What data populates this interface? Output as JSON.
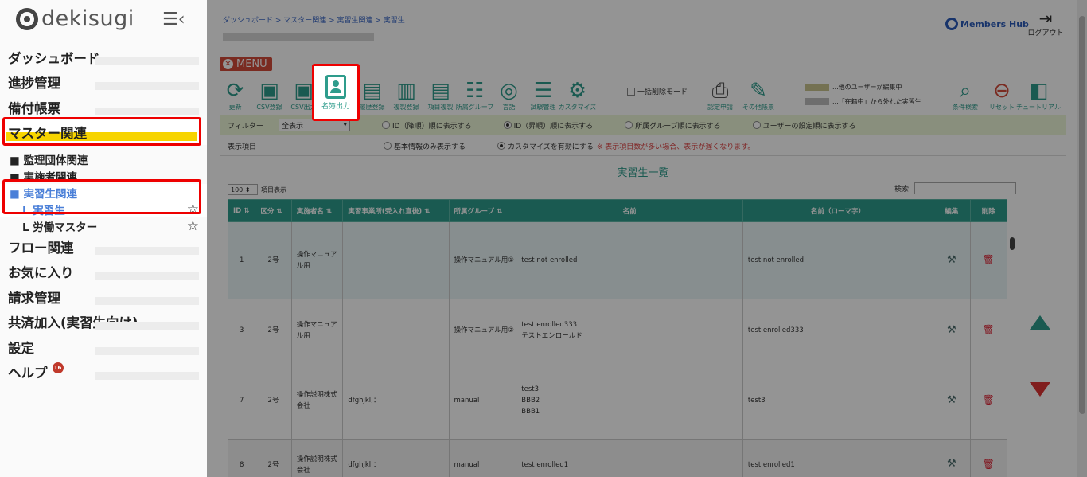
{
  "sidebar": {
    "logo_text": "dekisugi",
    "items": [
      {
        "label": "ダッシュボード"
      },
      {
        "label": "進捗管理"
      },
      {
        "label": "備付帳票"
      },
      {
        "label": "マスター関連"
      },
      {
        "label": "フロー関連"
      },
      {
        "label": "お気に入り"
      },
      {
        "label": "請求管理"
      },
      {
        "label": "共済加入(実習生向け)"
      },
      {
        "label": "設定"
      },
      {
        "label": "ヘルプ"
      }
    ],
    "sub_items": [
      {
        "label": "■ 監理団体関連"
      },
      {
        "label": "■ 実施者関連"
      },
      {
        "label": "■ 実習生関連"
      },
      {
        "label": "L 実習生"
      },
      {
        "label": "L 労働マスター"
      }
    ],
    "help_badge": "16",
    "star": "☆"
  },
  "header": {
    "breadcrumb": "ダッシュボード  >  マスター関連  >  実習生関連  >  実習生",
    "members_hub": "Members Hub",
    "logout_label": "ログアウト",
    "menu_label": "MENU"
  },
  "toolbar": {
    "tools": [
      {
        "label": "更新",
        "icon": "⟳"
      },
      {
        "label": "CSV登録",
        "icon": "▣"
      },
      {
        "label": "CSV出力",
        "icon": "▣"
      },
      {
        "label": "名簿出力",
        "icon": "person-card-icon"
      },
      {
        "label": "履歴登録",
        "icon": "▤"
      },
      {
        "label": "複製登録",
        "icon": "▥"
      },
      {
        "label": "項目複製",
        "icon": "▤"
      },
      {
        "label": "所属グループ",
        "icon": "☷"
      },
      {
        "label": "言語",
        "icon": "◎"
      },
      {
        "label": "試験管理",
        "icon": "☰"
      },
      {
        "label": "カスタマイズ",
        "icon": "⚙"
      }
    ],
    "bulk_delete": "一括削除モード",
    "tools_right": [
      {
        "label": "認定申請",
        "icon": "⎙"
      },
      {
        "label": "その他帳票",
        "icon": "✎"
      }
    ],
    "legend": [
      {
        "label": "...他のユーザーが編集中",
        "color": "#c9c38e"
      },
      {
        "label": "...「在籍中」から外れた実習生",
        "color": "#bdbdbd"
      }
    ],
    "tools_far": [
      {
        "label": "条件検索",
        "icon": "⌕"
      },
      {
        "label": "リセット",
        "icon": "⊖"
      },
      {
        "label": "チュートリアル",
        "icon": "◧"
      }
    ]
  },
  "filter": {
    "label": "フィルター",
    "selected": "全表示",
    "options": [
      "ID（降順）順に表示する",
      "ID（昇順）順に表示する",
      "所属グループ順に表示する",
      "ユーザーの設定順に表示する"
    ],
    "display_label": "表示項目",
    "display_options": [
      "基本情報のみ表示する",
      "カスタマイズを有効にする"
    ],
    "warning": "※ 表示項目数が多い場合、表示が遅くなります。"
  },
  "table": {
    "title": "実習生一覧",
    "length_value": "100",
    "length_label": "項目表示",
    "search_label": "検索:",
    "columns": [
      "ID",
      "区分",
      "実施者名",
      "実習事業所(受入れ直後)",
      "所属グループ",
      "名前",
      "名前（ローマ字）",
      "編集",
      "削除"
    ],
    "rows": [
      {
        "id": "1",
        "kubun": "2号",
        "company": "操作マニュアル用",
        "office": "",
        "group": "操作マニュアル用①",
        "name": "test not enrolled",
        "roman": "test not enrolled"
      },
      {
        "id": "3",
        "kubun": "2号",
        "company": "操作マニュアル用",
        "office": "",
        "group": "操作マニュアル用②",
        "name": "test enrolled333\nテストエンロールド",
        "roman": "test enrolled333"
      },
      {
        "id": "7",
        "kubun": "2号",
        "company": "操作説明株式会社",
        "office": "dfghjkl;：",
        "group": "manual",
        "name": "test3\nBBB2\nBBB1",
        "roman": "test3"
      },
      {
        "id": "8",
        "kubun": "2号",
        "company": "操作説明株式会社",
        "office": "dfghjkl;：",
        "group": "manual",
        "name": "test enrolled1",
        "roman": "test enrolled1"
      }
    ],
    "edit_icon": "⚒",
    "delete_icon": "🗑"
  }
}
